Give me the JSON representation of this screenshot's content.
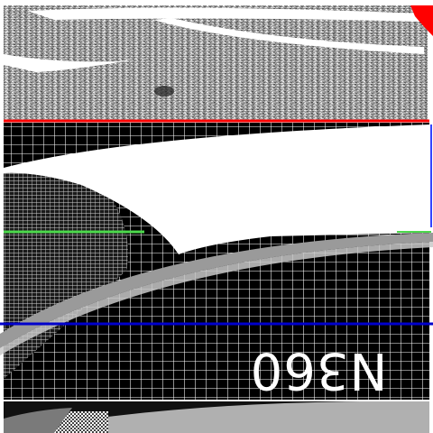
{
  "panel": {
    "label": "N360"
  },
  "colors": {
    "background": "#ffffff",
    "texture_light": "#c8c8c8",
    "texture_dark": "#5a5a5a",
    "grid_background": "#000000",
    "grid_lines": "#ffffff",
    "band_gray": "#9a9a9a",
    "band_light": "#c9c9c9",
    "marker_red": "#ff0000",
    "marker_green": "#4cd94c",
    "marker_blue": "#0000cc",
    "label_text": "#ffffff"
  },
  "icons": {
    "corner_marker": "red-corner-marker"
  }
}
